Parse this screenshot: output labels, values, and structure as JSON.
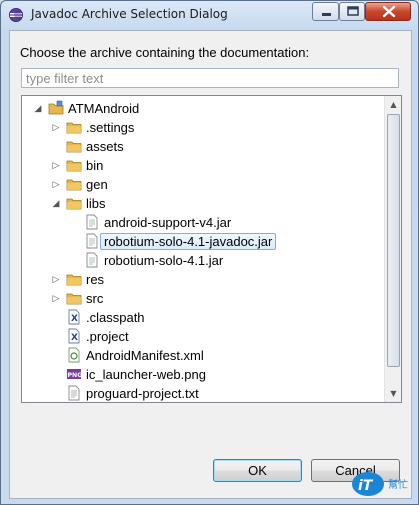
{
  "window": {
    "title": "Javadoc Archive Selection Dialog",
    "close_symbol": "✕",
    "max_symbol": "□",
    "min_symbol": "—"
  },
  "dialog": {
    "prompt": "Choose the archive containing the documentation:",
    "filter": {
      "value": "",
      "placeholder": "type filter text"
    }
  },
  "tree": {
    "items": [
      {
        "label": "ATMAndroid",
        "icon": "project-icon",
        "expanded": true
      },
      {
        "label": ".settings",
        "icon": "folder-icon",
        "expanded": false
      },
      {
        "label": "assets",
        "icon": "folder-icon"
      },
      {
        "label": "bin",
        "icon": "folder-icon",
        "expanded": false
      },
      {
        "label": "gen",
        "icon": "folder-icon",
        "expanded": false
      },
      {
        "label": "libs",
        "icon": "folder-icon",
        "expanded": true
      },
      {
        "label": "android-support-v4.jar",
        "icon": "jar-file-icon"
      },
      {
        "label": "robotium-solo-4.1-javadoc.jar",
        "icon": "jar-file-icon",
        "selected": true
      },
      {
        "label": "robotium-solo-4.1.jar",
        "icon": "jar-file-icon"
      },
      {
        "label": "res",
        "icon": "folder-icon",
        "expanded": false
      },
      {
        "label": "src",
        "icon": "folder-icon",
        "expanded": false
      },
      {
        "label": ".classpath",
        "icon": "xml-file-icon"
      },
      {
        "label": ".project",
        "icon": "xml-file-icon"
      },
      {
        "label": "AndroidManifest.xml",
        "icon": "manifest-file-icon"
      },
      {
        "label": "ic_launcher-web.png",
        "icon": "png-file-icon"
      },
      {
        "label": "proguard-project.txt",
        "icon": "text-file-icon"
      }
    ]
  },
  "buttons": {
    "ok": "OK",
    "cancel": "Cancel"
  },
  "watermark": {
    "text_main": "iT",
    "text_small": "邦",
    "text_side": "幫忙"
  },
  "colors": {
    "folder": "#e8b64a",
    "selection_border": "#84acdd",
    "jar_gray": "#8a8a8a",
    "png_purple": "#7c3a9c"
  }
}
